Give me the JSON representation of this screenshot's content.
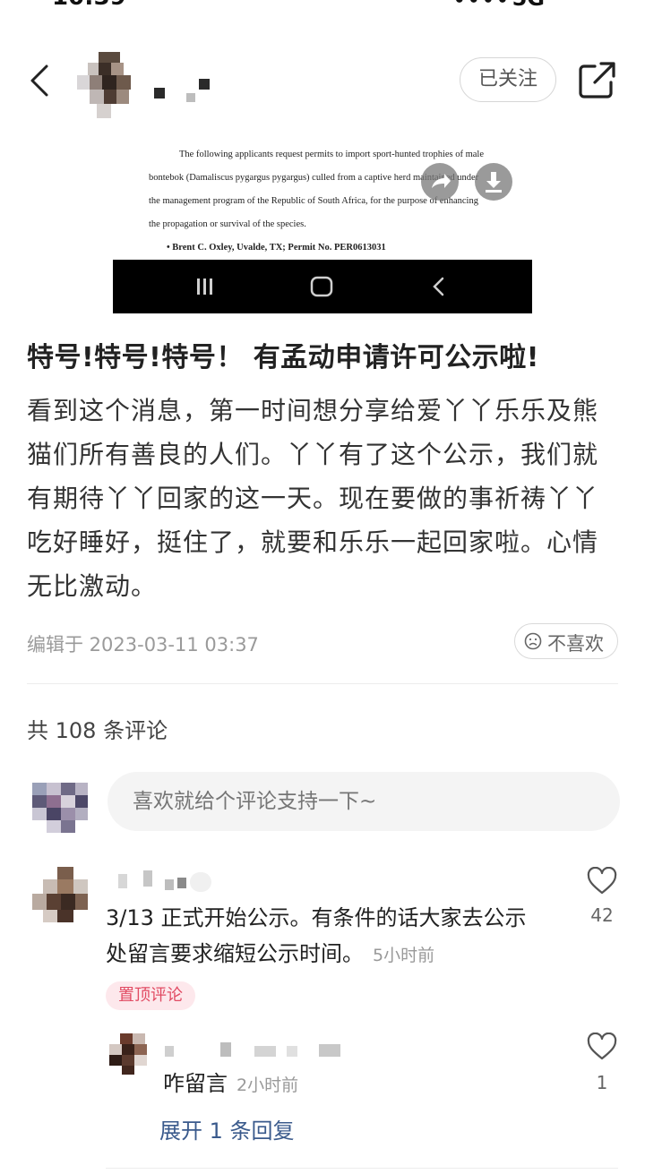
{
  "status_bar": {
    "time": "10:39",
    "signal": "5G"
  },
  "header": {
    "follow_label": "已关注"
  },
  "image": {
    "doc_lines": [
      "The following applicants request permits to import sport-hunted trophies of male",
      "bontebok (Damaliscus pygargus pygargus) culled from a captive herd maintained under",
      "the management program of the Republic of South Africa, for the purpose of enhancing",
      "the propagation or survival of the species."
    ],
    "doc_bullet": "•  Brent C. Oxley, Uvalde, TX; Permit No. PER0613031"
  },
  "post": {
    "title": "特号!特号!特号！ 有孟动申请许可公示啦!",
    "body": "看到这个消息，第一时间想分享给爱丫丫乐乐及熊猫们所有善良的人们。丫丫有了这个公示，我们就有期待丫丫回家的这一天。现在要做的事祈祷丫丫吃好睡好，挺住了，就要和乐乐一起回家啦。心情无比激动。",
    "edit_time": "编辑于 2023-03-11 03:37",
    "dislike_label": "不喜欢"
  },
  "comments_section": {
    "count_label": "共 108 条评论",
    "input_placeholder": "喜欢就给个评论支持一下~"
  },
  "comments": [
    {
      "text": "3/13 正式开始公示。有条件的话大家去公示处留言要求缩短公示时间。",
      "time": "5小时前",
      "likes": "42",
      "badge": "置顶评论"
    },
    {
      "text": "咋留言",
      "time": "2小时前",
      "likes": "1"
    }
  ],
  "expand_replies_label": "展开 1 条回复",
  "colors": {
    "accent_pink": "#e14b63",
    "link_blue": "#3a5a8c"
  }
}
